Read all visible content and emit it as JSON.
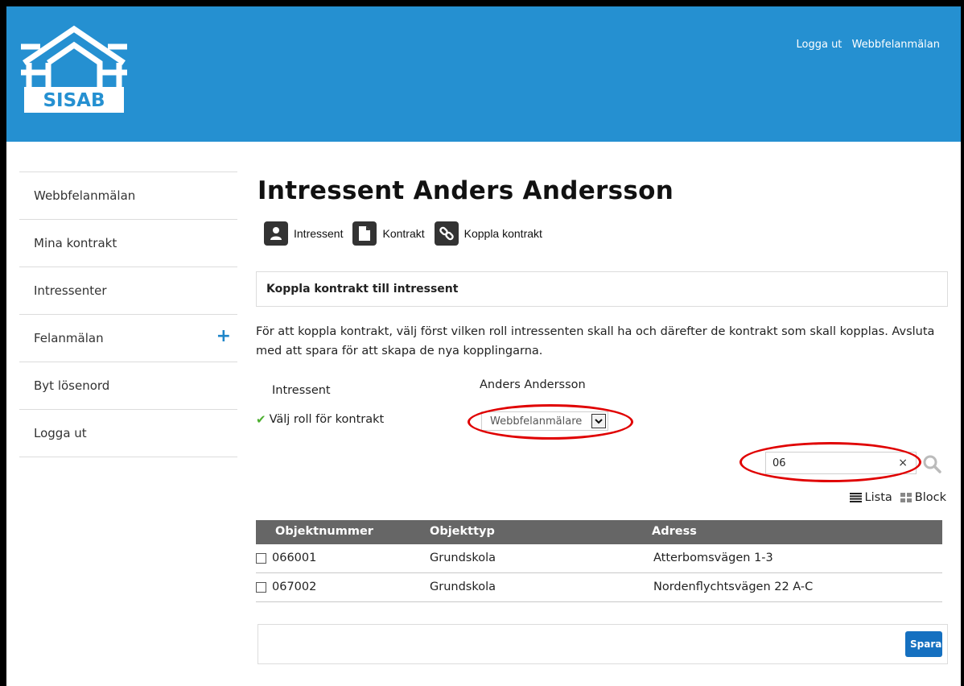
{
  "header": {
    "logo_text": "SISAB",
    "links": [
      "Logga ut",
      "Webbfelanmälan"
    ],
    "background": "#2590d1"
  },
  "sidebar": {
    "items": [
      {
        "label": "Webbfelanmälan"
      },
      {
        "label": "Mina kontrakt"
      },
      {
        "label": "Intressenter"
      },
      {
        "label": "Felanmälan",
        "icon": "plus-icon"
      },
      {
        "label": "Byt lösenord"
      },
      {
        "label": "Logga ut"
      }
    ]
  },
  "main": {
    "title": "Intressent Anders Andersson",
    "tabs": [
      {
        "label": "Intressent",
        "icon": "person-icon"
      },
      {
        "label": "Kontrakt",
        "icon": "document-icon"
      },
      {
        "label": "Koppla kontrakt",
        "icon": "link-icon"
      }
    ],
    "panel_title": "Koppla kontrakt till intressent",
    "description": "För att koppla kontrakt, välj först vilken roll intressenten skall ha och därefter de kontrakt som skall kopplas. Avsluta med att spara för att skapa de nya kopplingarna.",
    "form": {
      "intressent_label": "Intressent",
      "intressent_value": "Anders Andersson",
      "role_label": "Välj roll för kontrakt",
      "role_selected": "Webbfelanmälare"
    },
    "search": {
      "value": "06",
      "clear": "×"
    },
    "view_modes": [
      {
        "label": "Lista",
        "icon": "list-icon"
      },
      {
        "label": "Block",
        "icon": "grid-icon"
      }
    ],
    "table": {
      "headers": [
        "Objektnummer",
        "Objekttyp",
        "Adress"
      ],
      "rows": [
        {
          "objektnummer": "066001",
          "objekttyp": "Grundskola",
          "adress": "Atterbomsvägen 1-3"
        },
        {
          "objektnummer": "067002",
          "objekttyp": "Grundskola",
          "adress": "Nordenflychtsvägen 22 A-C"
        }
      ]
    },
    "save_label": "Spara"
  },
  "colors": {
    "accent": "#2590d1",
    "button": "#1570c0",
    "annotation": "#e00000",
    "table_header": "#666666",
    "check": "#4caf2f"
  }
}
